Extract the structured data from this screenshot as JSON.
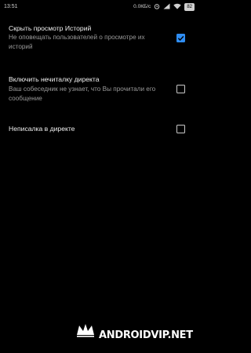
{
  "status_bar": {
    "time": "13:51",
    "network_speed": "0.0КБ/с",
    "battery": "82",
    "icons": [
      "alarm-icon",
      "signal-icon",
      "wifi-icon",
      "battery-icon"
    ]
  },
  "settings": [
    {
      "title": "Скрыть просмотр Историй",
      "summary": "Не оповещать пользователей о просмотре их историй",
      "checked": true
    },
    {
      "title": "Включить нечиталку директа",
      "summary": "Ваш собеседник не узнает, что Вы прочитали его сообщение",
      "checked": false
    },
    {
      "title": "Неписалка в директе",
      "summary": "",
      "checked": false
    }
  ],
  "watermark": {
    "text": "ANDROIDVIP.NET",
    "icon": "crown-logo-icon"
  },
  "colors": {
    "background": "#000000",
    "accent": "#2f8df2",
    "title_text": "#f2f2f2",
    "summary_text": "#9a9a9a"
  }
}
